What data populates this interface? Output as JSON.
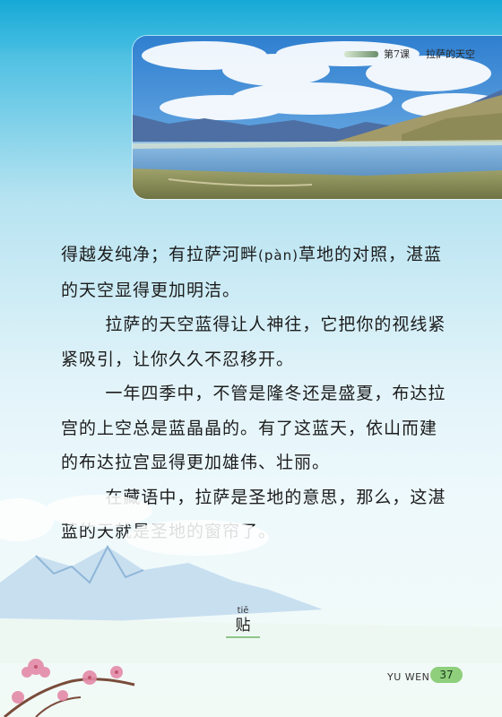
{
  "header": {
    "lesson": "第7课",
    "title": "拉萨的天空"
  },
  "body": {
    "p1": {
      "before": "得越发纯净；有拉萨河畔",
      "pinyin": "(pàn)",
      "after": "草地的对照，湛蓝的天空显得更加明洁。"
    },
    "p2": "拉萨的天空蓝得让人神往，它把你的视线紧紧吸引，让你久久不忍移开。",
    "p3": "一年四季中，不管是隆冬还是盛夏，布达拉宫的上空总是蓝晶晶的。有了这蓝天，依山而建的布达拉宫显得更加雄伟、壮丽。",
    "p4": "在藏语中，拉萨是圣地的意思，那么，这湛蓝的天就是圣地的窗帘了。"
  },
  "vocab": {
    "pinyin": "tiē",
    "char": "贴"
  },
  "footer": {
    "label": "YU WEN",
    "page": "37"
  }
}
